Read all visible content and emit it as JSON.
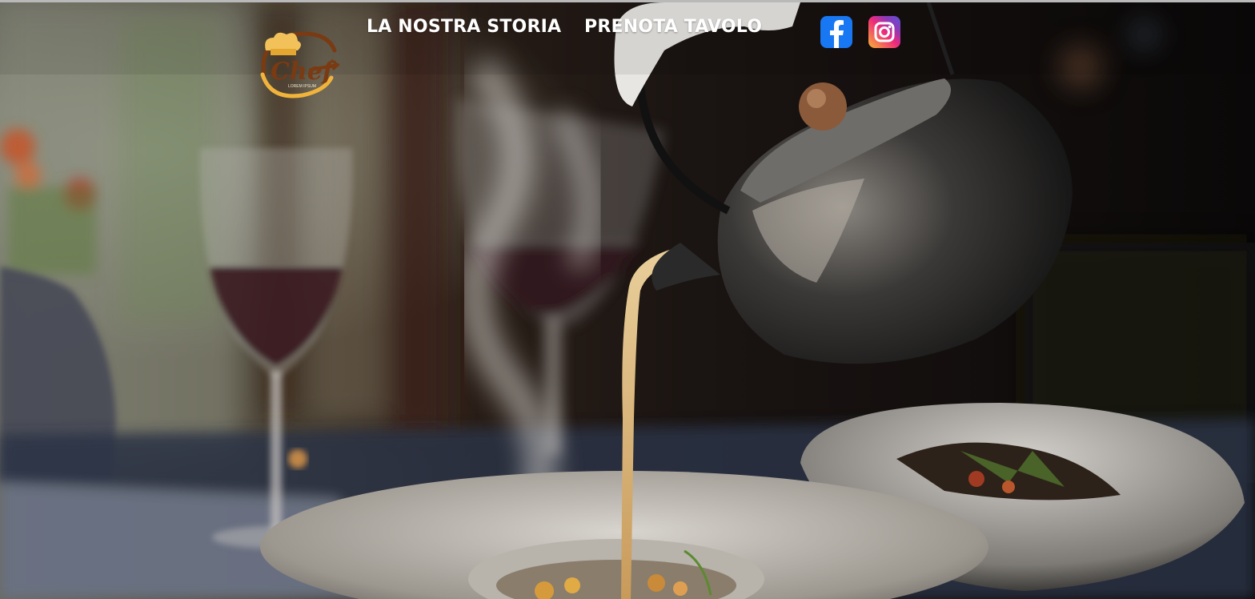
{
  "nav": {
    "links": [
      {
        "label": "LA NOSTRA STORIA"
      },
      {
        "label": "PRENOTA TAVOLO"
      }
    ]
  },
  "logo": {
    "wordmark": "Chef",
    "tagline": "LOREM IPSUM"
  },
  "social": {
    "facebook_icon": "facebook-icon",
    "instagram_icon": "instagram-icon"
  },
  "colors": {
    "nav_text": "#ffffff",
    "facebook_blue": "#1877f2",
    "logo_brown": "#7a3a12",
    "logo_gold": "#f0b43c"
  }
}
